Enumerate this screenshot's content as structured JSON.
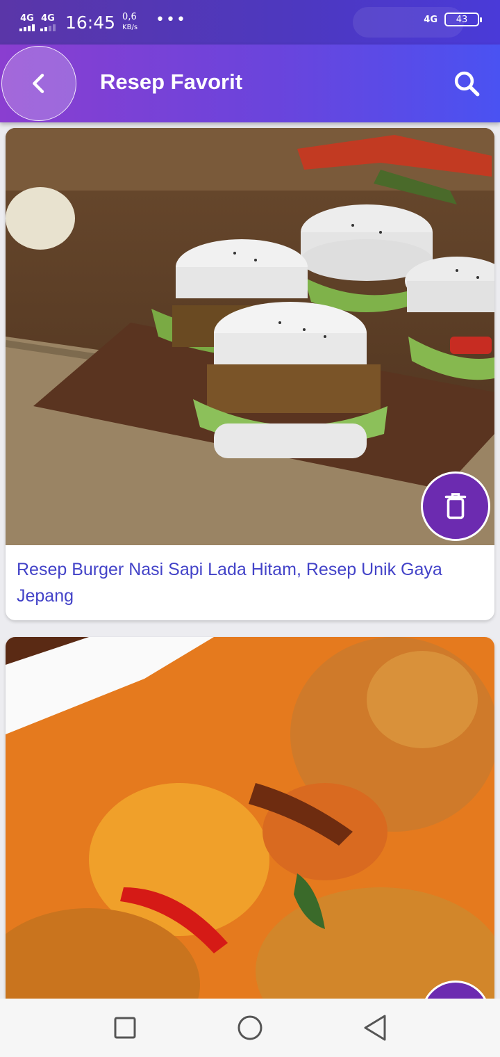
{
  "status_bar": {
    "sim1": "4G",
    "sim2": "4G",
    "time": "16:45",
    "speed_value": "0,6",
    "speed_unit": "KB/s",
    "more": "•••",
    "network_right": "4G",
    "battery": "43"
  },
  "app_bar": {
    "title": "Resep Favorit",
    "back_icon": "chevron-left-icon",
    "search_icon": "search-icon"
  },
  "recipes": [
    {
      "title": "Resep Burger Nasi Sapi Lada Hitam, Resep Unik Gaya Jepang",
      "image": "rice-burger-photo",
      "delete_icon": "trash-icon"
    },
    {
      "title": "",
      "image": "curry-photo",
      "delete_icon": "trash-icon"
    }
  ],
  "nav_bar": {
    "recents_icon": "square-icon",
    "home_icon": "circle-icon",
    "back_icon": "triangle-back-icon"
  },
  "colors": {
    "primary": "#6c2bb0",
    "title_text": "#4343c8",
    "app_bar_start": "#8a3ed0",
    "app_bar_end": "#4a52f2"
  }
}
